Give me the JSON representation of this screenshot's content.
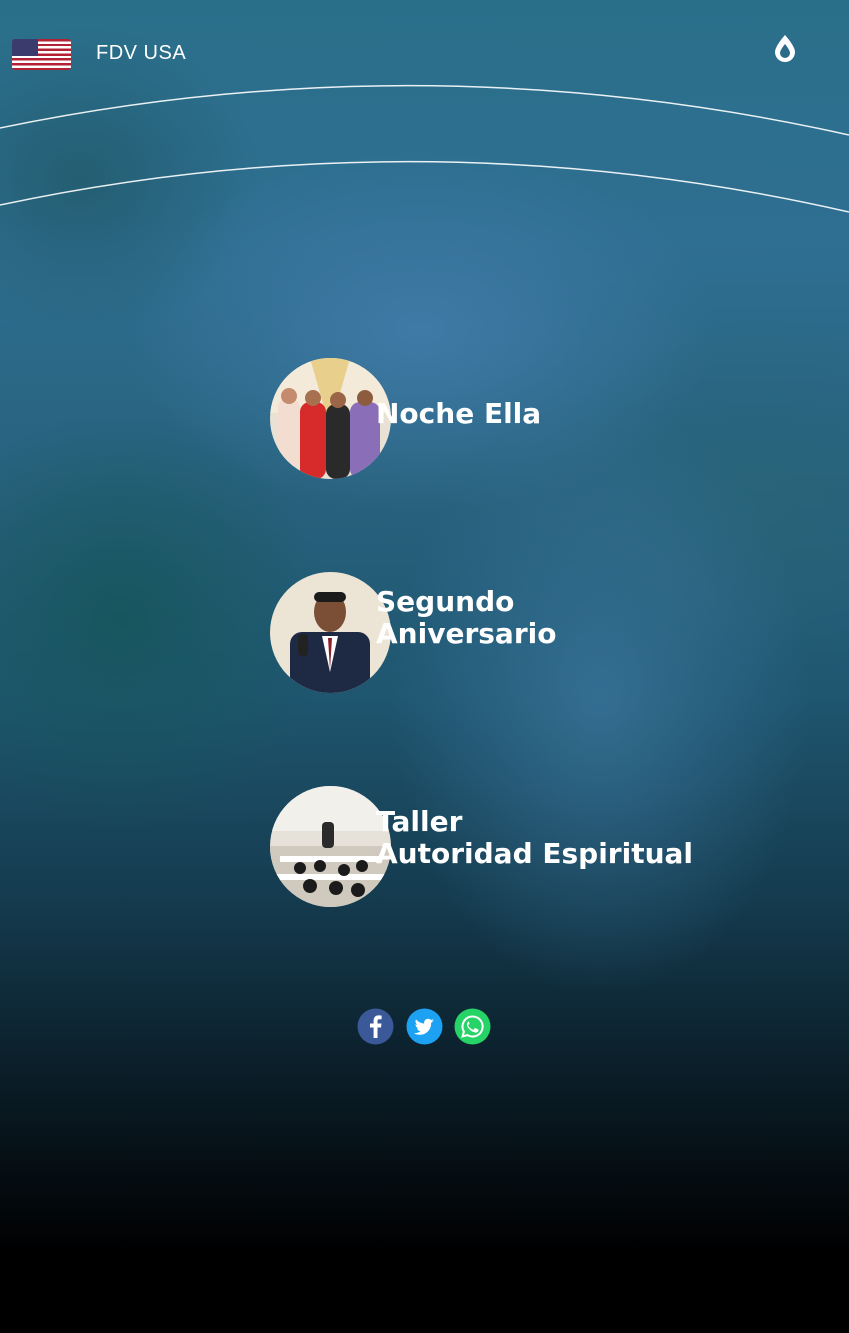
{
  "header": {
    "brand": "FDV USA",
    "flag_icon": "us-flag-icon",
    "menu_icon": "droplet-icon"
  },
  "events": [
    {
      "title_lines": [
        "Noche Ella"
      ]
    },
    {
      "title_lines": [
        "Segundo",
        "Aniversario"
      ]
    },
    {
      "title_lines": [
        "Taller",
        "Autoridad Espiritual"
      ]
    }
  ],
  "social": [
    {
      "icon": "facebook-icon",
      "color": "#3b5998"
    },
    {
      "icon": "twitter-icon",
      "color": "#1da1f2"
    },
    {
      "icon": "whatsapp-icon",
      "color": "#25d366"
    }
  ],
  "colors": {
    "text": "#ffffff",
    "background_bottom": "#000000"
  }
}
